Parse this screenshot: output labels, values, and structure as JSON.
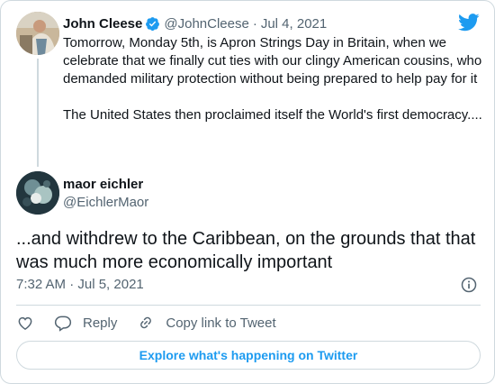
{
  "colors": {
    "brand": "#1d9bf0",
    "text": "#0f1419",
    "secondary": "#536471",
    "border": "#cfd9de"
  },
  "parent_tweet": {
    "author_name": "John Cleese",
    "author_handle": "@JohnCleese",
    "separator": "·",
    "date": "Jul 4, 2021",
    "verified_icon": "verified-badge-icon",
    "paragraph_1": "Tomorrow, Monday 5th, is Apron Strings Day in Britain, when we celebrate that we finally cut ties with our clingy American cousins, who demanded military protection without being prepared to help pay for it",
    "paragraph_2": "The United States then proclaimed itself the World's first democracy...."
  },
  "reply_tweet": {
    "author_name": "maor eichler",
    "author_handle": "@EichlerMaor",
    "text": "...and withdrew to the Caribbean, on the grounds that that was much more economically important",
    "timestamp": "7:32 AM · Jul 5, 2021"
  },
  "actions": {
    "like_icon": "heart-icon",
    "reply_label": "Reply",
    "reply_icon": "reply-icon",
    "copy_link_label": "Copy link to Tweet",
    "copy_link_icon": "link-icon",
    "info_icon": "info-icon"
  },
  "explore_button": {
    "label": "Explore what's happening on Twitter"
  },
  "logo": "twitter-bird-icon"
}
